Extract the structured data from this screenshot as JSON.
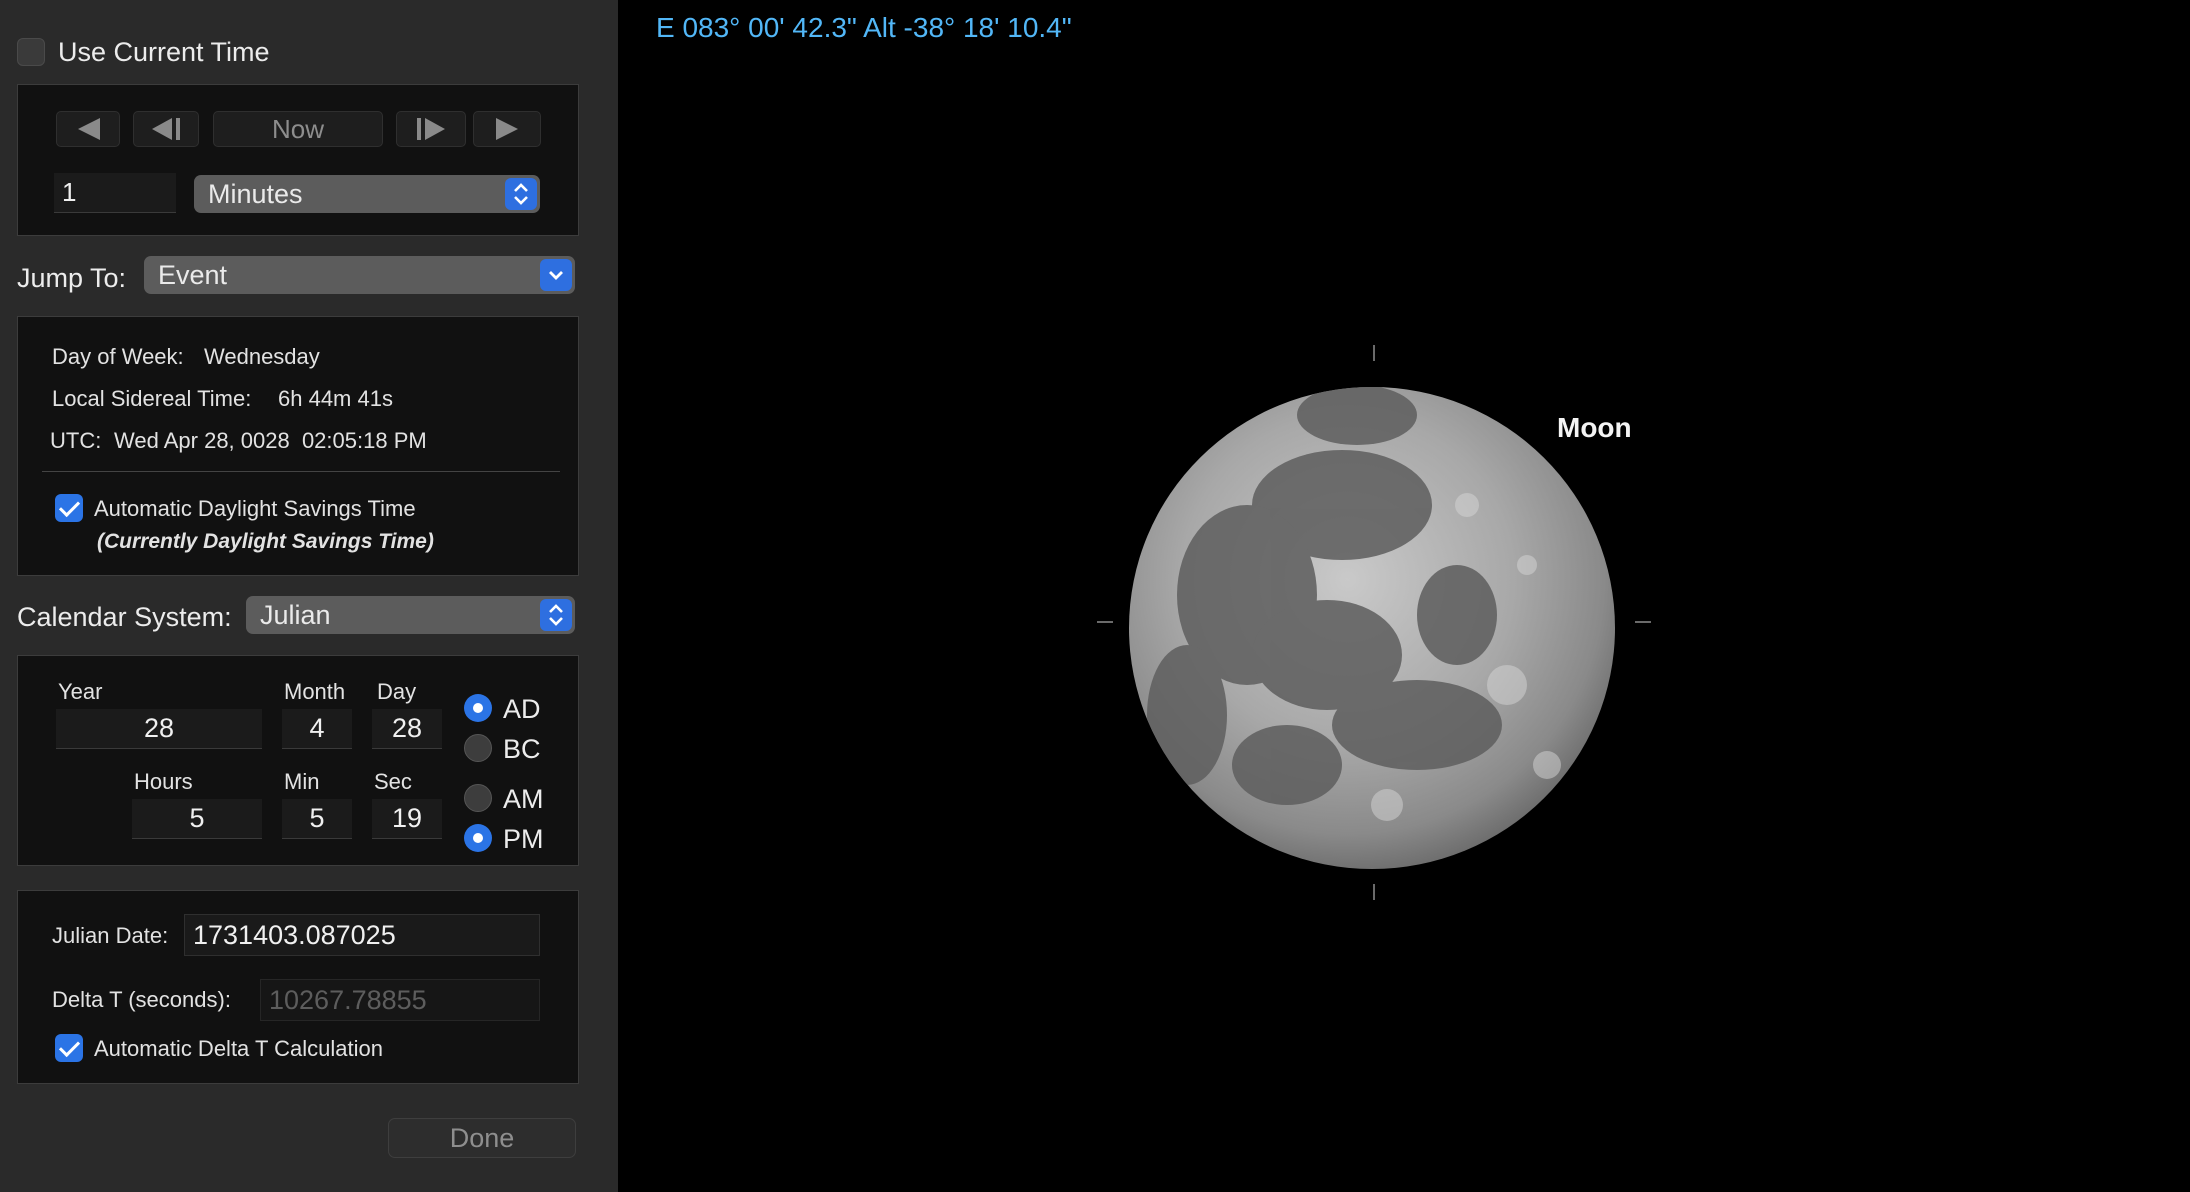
{
  "time_panel": {
    "use_current_time_label": "Use Current Time",
    "use_current_time_checked": false,
    "step_buttons": {
      "rewind_icon": "rewind-icon",
      "step_back_icon": "step-back-icon",
      "now_label": "Now",
      "step_forward_icon": "step-forward-icon",
      "play_icon": "play-icon"
    },
    "step_amount": "1",
    "step_unit": "Minutes",
    "jump_to_label": "Jump To:",
    "jump_to_value": "Event",
    "info": {
      "day_of_week_label": "Day of Week:",
      "day_of_week_value": "Wednesday",
      "sidereal_label": "Local Sidereal Time:",
      "sidereal_value": "6h 44m 41s",
      "utc_label": "UTC:",
      "utc_value": "Wed Apr 28, 0028  02:05:18 PM",
      "auto_dst_label": "Automatic Daylight Savings Time",
      "auto_dst_checked": true,
      "dst_status": "(Currently Daylight Savings Time)"
    },
    "calendar_system_label": "Calendar System:",
    "calendar_system_value": "Julian",
    "date_fields": {
      "year_label": "Year",
      "year_value": "28",
      "month_label": "Month",
      "month_value": "4",
      "day_label": "Day",
      "day_value": "28",
      "hours_label": "Hours",
      "hours_value": "5",
      "min_label": "Min",
      "min_value": "5",
      "sec_label": "Sec",
      "sec_value": "19",
      "era_ad_label": "AD",
      "era_bc_label": "BC",
      "era_selected": "AD",
      "am_label": "AM",
      "pm_label": "PM",
      "meridiem_selected": "PM"
    },
    "julian": {
      "julian_date_label": "Julian Date:",
      "julian_date_value": "1731403.087025",
      "delta_t_label": "Delta T (seconds):",
      "delta_t_value": "10267.78855",
      "auto_delta_t_label": "Automatic Delta T Calculation",
      "auto_delta_t_checked": true
    },
    "done_label": "Done"
  },
  "sky_view": {
    "coordinates": "E 083° 00' 42.3\" Alt -38° 18' 10.4\"",
    "object_label": "Moon",
    "accent_color": "#52b7f7"
  }
}
